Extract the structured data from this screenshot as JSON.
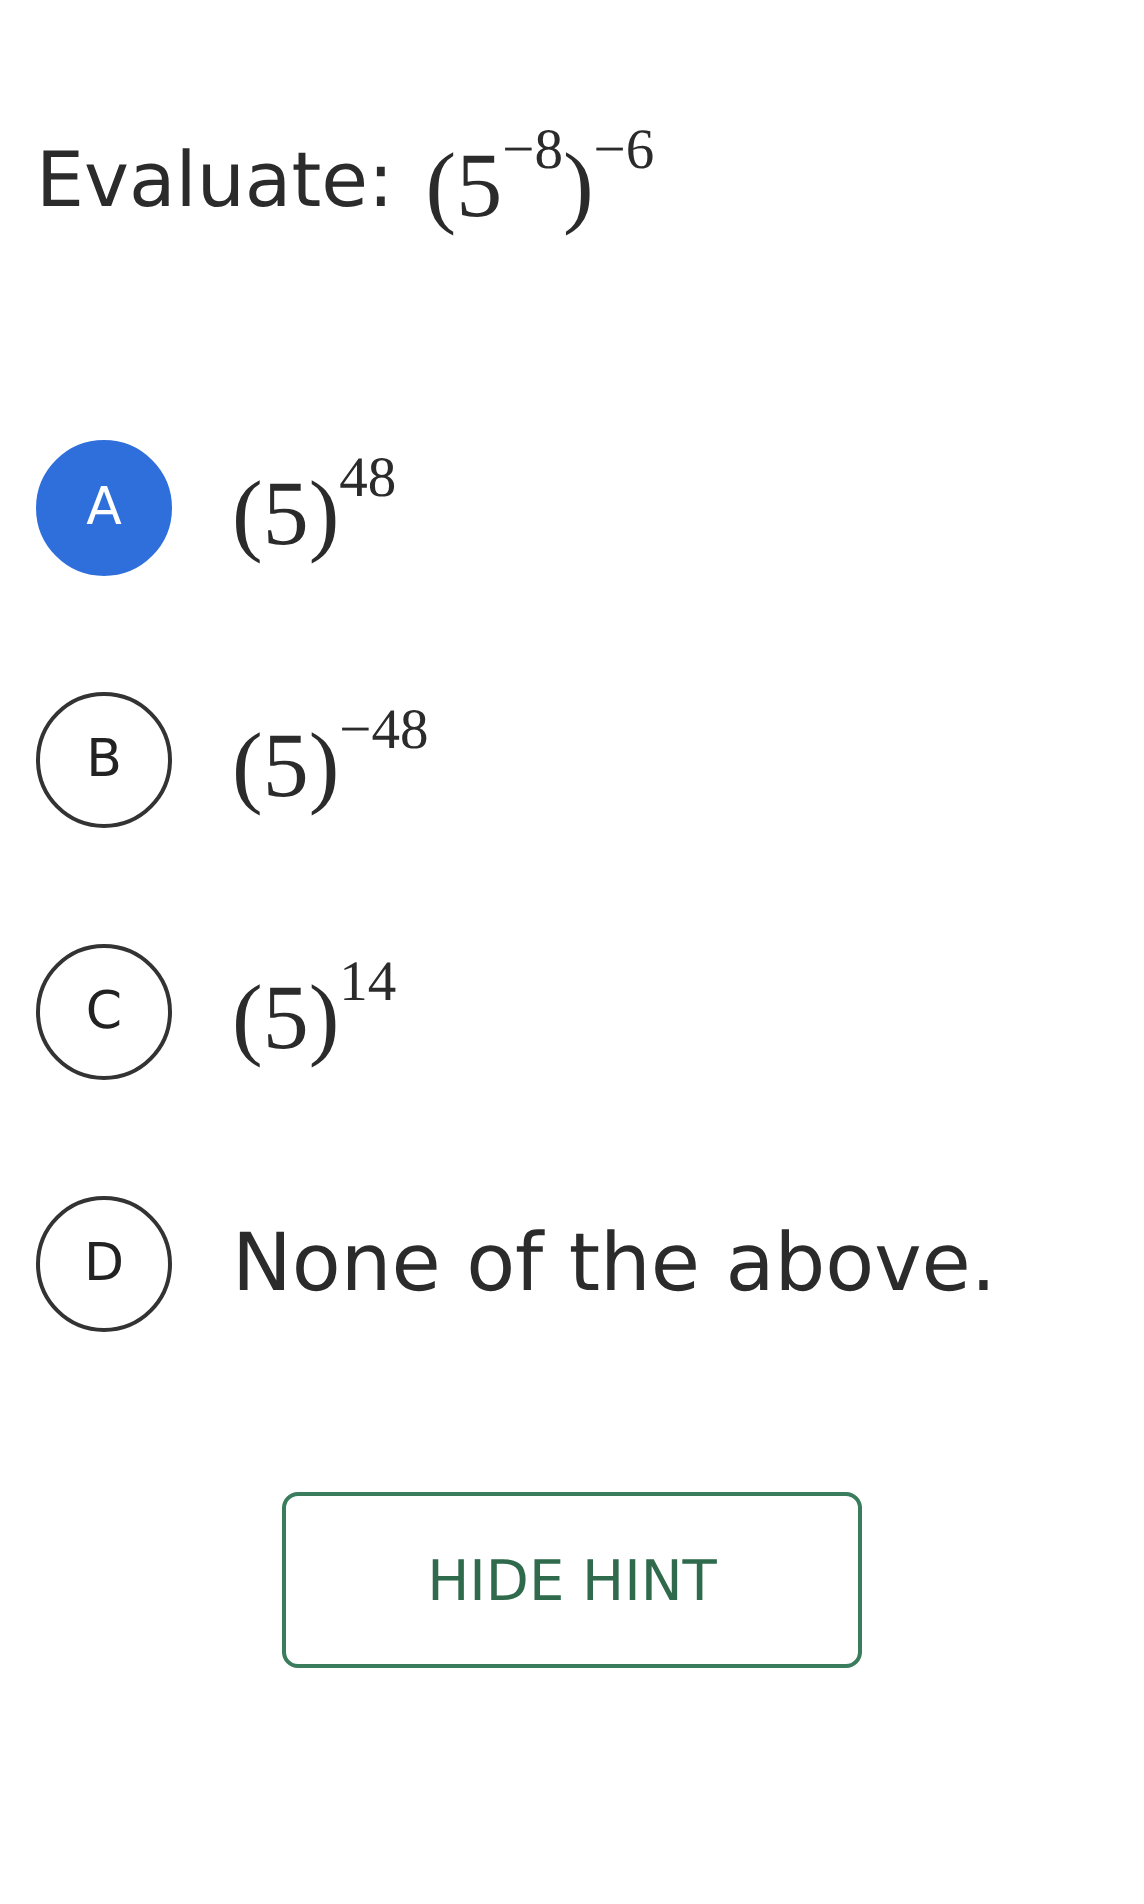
{
  "question": {
    "label": "Evaluate:",
    "expression": "(5$^{−8}$)$^{−6}$"
  },
  "options": [
    {
      "letter": "A",
      "kind": "math",
      "text": "(5)$^{48}$",
      "selected": true
    },
    {
      "letter": "B",
      "kind": "math",
      "text": "(5)$^{−48}$",
      "selected": false
    },
    {
      "letter": "C",
      "kind": "math",
      "text": "(5)$^{14}$",
      "selected": false
    },
    {
      "letter": "D",
      "kind": "text",
      "text": "None of the above.",
      "selected": false
    }
  ],
  "hint_button": "HIDE HINT"
}
